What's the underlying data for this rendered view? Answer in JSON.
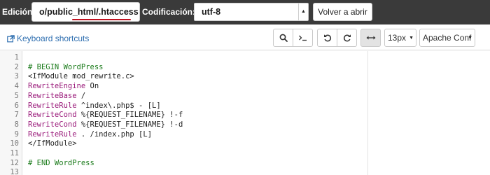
{
  "header": {
    "file_label": "Edición:",
    "file_path": "o/public_html/.htaccess",
    "encoding_label": "Codificación:",
    "encoding_value": "utf-8",
    "reopen_button": "Volver a abrir"
  },
  "toolbar": {
    "shortcuts_link": "Keyboard shortcuts",
    "font_size": "13px",
    "mode": "Apache Conf"
  },
  "editor": {
    "lines": [
      {
        "num": "1",
        "parts": []
      },
      {
        "num": "2",
        "parts": [
          {
            "t": "# BEGIN WordPress",
            "c": "comment"
          }
        ]
      },
      {
        "num": "3",
        "parts": [
          {
            "t": "<IfModule mod_rewrite.c>",
            "c": "default"
          }
        ]
      },
      {
        "num": "4",
        "parts": [
          {
            "t": "RewriteEngine",
            "c": "keyword"
          },
          {
            "t": " On",
            "c": "default"
          }
        ]
      },
      {
        "num": "5",
        "parts": [
          {
            "t": "RewriteBase",
            "c": "keyword"
          },
          {
            "t": " /",
            "c": "default"
          }
        ]
      },
      {
        "num": "6",
        "parts": [
          {
            "t": "RewriteRule",
            "c": "keyword"
          },
          {
            "t": " ^index\\.php$ - [L]",
            "c": "default"
          }
        ]
      },
      {
        "num": "7",
        "parts": [
          {
            "t": "RewriteCond",
            "c": "keyword"
          },
          {
            "t": " %{REQUEST_FILENAME} !-f",
            "c": "default"
          }
        ]
      },
      {
        "num": "8",
        "parts": [
          {
            "t": "RewriteCond",
            "c": "keyword"
          },
          {
            "t": " %{REQUEST_FILENAME} !-d",
            "c": "default"
          }
        ]
      },
      {
        "num": "9",
        "parts": [
          {
            "t": "RewriteRule",
            "c": "keyword"
          },
          {
            "t": " . /index.php [L]",
            "c": "default"
          }
        ]
      },
      {
        "num": "10",
        "parts": [
          {
            "t": "</IfModule>",
            "c": "default"
          }
        ]
      },
      {
        "num": "11",
        "parts": []
      },
      {
        "num": "12",
        "parts": [
          {
            "t": "# END WordPress",
            "c": "comment"
          }
        ]
      },
      {
        "num": "13",
        "parts": []
      }
    ]
  },
  "colors": {
    "topbar_bg": "#3a3a3a",
    "link": "#2f6fb0",
    "comment": "#1b7b1b",
    "keyword": "#9a1a7a",
    "highlight_underline": "#c0111f"
  },
  "icons": {
    "shortcuts": "external-link-icon",
    "search": "search-icon",
    "terminal": "terminal-icon",
    "undo": "undo-icon",
    "redo": "redo-icon",
    "wrap": "word-wrap-icon"
  }
}
